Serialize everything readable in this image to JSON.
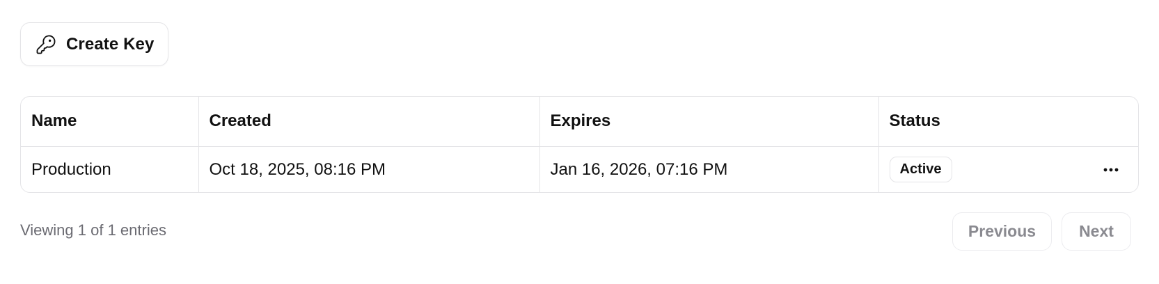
{
  "toolbar": {
    "create_label": "Create Key",
    "create_icon": "key-icon"
  },
  "table": {
    "columns": [
      "Name",
      "Created",
      "Expires",
      "Status"
    ],
    "rows": [
      {
        "name": "Production",
        "created": "Oct 18, 2025, 08:16 PM",
        "expires": "Jan 16, 2026, 07:16 PM",
        "status": "Active",
        "actions_icon": "more-horizontal-icon"
      }
    ]
  },
  "footer": {
    "summary": "Viewing 1 of 1 entries",
    "previous_label": "Previous",
    "next_label": "Next"
  },
  "colors": {
    "border": "#e4e4e7",
    "text": "#111111",
    "muted_text": "#6b6b72",
    "disabled_button_text": "#8a8a90"
  }
}
